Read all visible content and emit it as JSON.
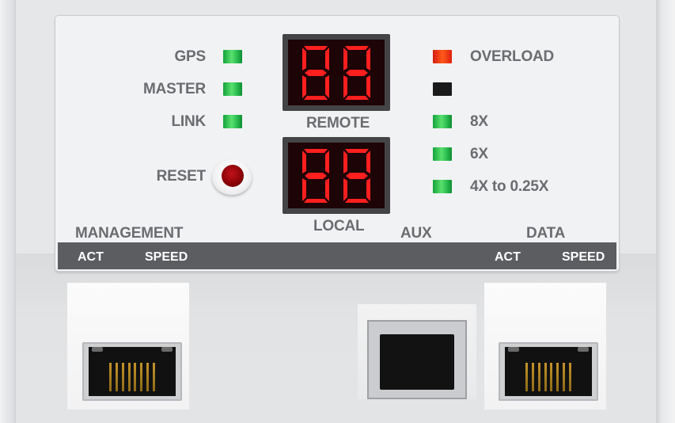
{
  "panel": {
    "left_labels": {
      "gps": "GPS",
      "master": "MASTER",
      "link": "LINK",
      "reset": "RESET"
    },
    "center_labels": {
      "remote": "REMOTE",
      "local": "LOCAL"
    },
    "right_labels": {
      "overload": "OVERLOAD",
      "r8x": "8X",
      "r6x": "6X",
      "r4x": "4X to 0.25X"
    },
    "led_status": {
      "gps": "green-on",
      "master": "green-on",
      "link": "green-on",
      "overload": "red-on",
      "blank": "off",
      "r8x": "green-on",
      "r6x": "green-on",
      "r4x": "green-on"
    },
    "remote_display": "88",
    "local_display": "88"
  },
  "ports": {
    "management": "MANAGEMENT",
    "aux": "AUX",
    "data": "DATA",
    "mgmt_act": "ACT",
    "mgmt_speed": "SPEED",
    "data_act": "ACT",
    "data_speed": "SPEED"
  },
  "colors": {
    "led_green": "#2fc153",
    "led_red": "#e0200f",
    "segment_on": "#ff1f1f",
    "segment_off": "#3a0608",
    "panel_bg": "#f1f2f3",
    "label_gray": "#6b6c70",
    "bar": "#5c5d61"
  }
}
